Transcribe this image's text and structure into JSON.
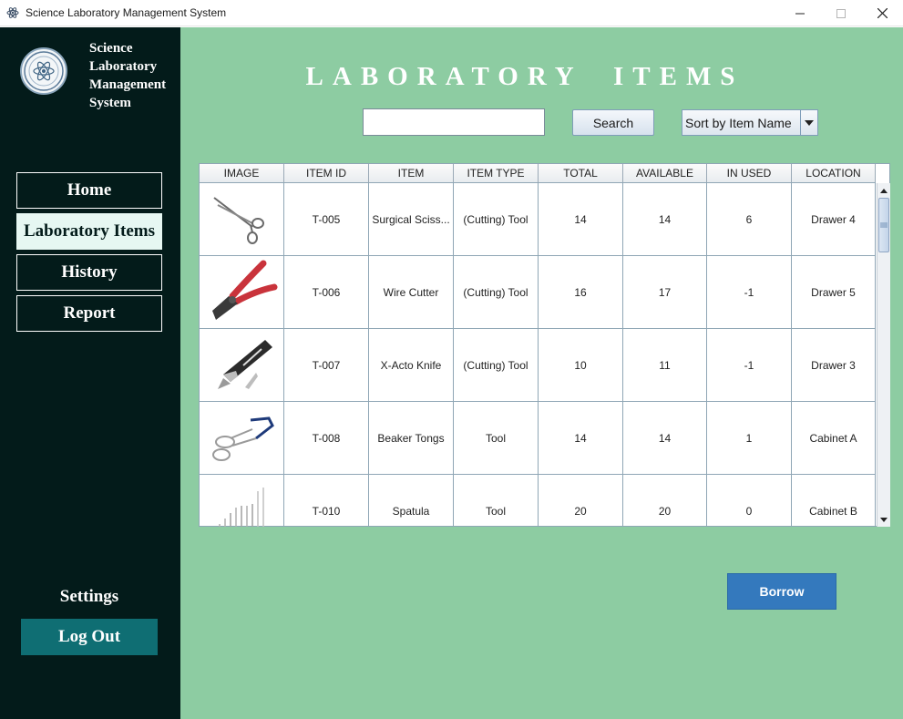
{
  "window": {
    "title": "Science Laboratory Management System",
    "icons": {
      "app": "atom-icon",
      "minimize": "minimize-icon",
      "maximize": "maximize-icon",
      "close": "close-icon"
    }
  },
  "sidebar": {
    "brand": [
      "Science",
      "Laboratory",
      "Management",
      "System"
    ],
    "logo_icon": "atom-seal-logo",
    "nav": {
      "home": "Home",
      "lab_items": "Laboratory Items",
      "history": "History",
      "report": "Report"
    },
    "active": "lab_items",
    "settings": "Settings",
    "logout": "Log Out"
  },
  "main": {
    "title": [
      "LABORATORY",
      "ITEMS"
    ],
    "search": {
      "value": "",
      "placeholder": "",
      "button": "Search"
    },
    "sort": {
      "selected": "Sort by Item Name"
    },
    "borrow": "Borrow"
  },
  "table": {
    "columns": [
      "IMAGE",
      "ITEM ID",
      "ITEM",
      "ITEM TYPE",
      "TOTAL",
      "AVAILABLE",
      "IN USED",
      "LOCATION"
    ],
    "rows": [
      {
        "image": "surgical-scissors-image",
        "id": "T-005",
        "item": "Surgical Sciss...",
        "type": "(Cutting) Tool",
        "total": "14",
        "available": "14",
        "in_used": "6",
        "location": "Drawer 4"
      },
      {
        "image": "wire-cutter-image",
        "id": "T-006",
        "item": "Wire Cutter",
        "type": "(Cutting) Tool",
        "total": "16",
        "available": "17",
        "in_used": "-1",
        "location": "Drawer 5"
      },
      {
        "image": "x-acto-knife-image",
        "id": "T-007",
        "item": "X-Acto Knife",
        "type": "(Cutting) Tool",
        "total": "10",
        "available": "11",
        "in_used": "-1",
        "location": "Drawer 3"
      },
      {
        "image": "beaker-tongs-image",
        "id": "T-008",
        "item": "Beaker Tongs",
        "type": "Tool",
        "total": "14",
        "available": "14",
        "in_used": "1",
        "location": "Cabinet A"
      },
      {
        "image": "spatula-image",
        "id": "T-010",
        "item": "Spatula",
        "type": "Tool",
        "total": "20",
        "available": "20",
        "in_used": "0",
        "location": "Cabinet B"
      }
    ]
  },
  "colors": {
    "sidebar_bg": "#031b1a",
    "main_bg": "#8dcca2",
    "active_nav_bg": "#e6f7f2",
    "logout_bg": "#0f6e73",
    "borrow_bg": "#3479bd"
  }
}
